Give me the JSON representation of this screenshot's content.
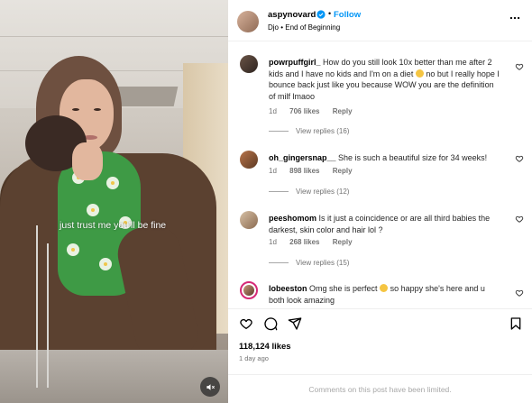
{
  "post": {
    "author": "aspynovard",
    "follow_label": "Follow",
    "audio": "Djo • End of Beginning",
    "video_overlay_text": "just trust me you'll be fine",
    "likes": "118,124 likes",
    "time_ago": "1 day ago",
    "comments_limited": "Comments on this post have been limited."
  },
  "comments": [
    {
      "user": "powrpuffgirl_",
      "text_before": "How do you still look 10x better than me after 2 kids and I have no kids and I'm on a diet",
      "text_after": " no but I really hope I bounce back just like you because WOW you are the definition of milf lmaoo",
      "age": "1d",
      "likes": "706 likes",
      "reply_label": "Reply",
      "view_replies": "View replies (16)"
    },
    {
      "user": "oh_gingersnap__",
      "text_before": "She is such a beautiful size for 34 weeks!",
      "text_after": "",
      "age": "1d",
      "likes": "898 likes",
      "reply_label": "Reply",
      "view_replies": "View replies (12)"
    },
    {
      "user": "peeshomom",
      "text_before": "Is it just a coincidence or are all third babies the darkest, skin color and hair lol ?",
      "text_after": "",
      "age": "1d",
      "likes": "268 likes",
      "reply_label": "Reply",
      "view_replies": "View replies (15)"
    },
    {
      "user": "lobeeston",
      "text_before": "Omg she is perfect",
      "text_after": " so happy she's here and u both look amazing",
      "age": "",
      "likes": "",
      "reply_label": "",
      "view_replies": ""
    }
  ],
  "colors": {
    "accent": "#0095f6",
    "muted": "#737373",
    "verified": "#0095f6"
  },
  "icons": [
    "more-icon",
    "heart-icon",
    "comment-icon",
    "share-icon",
    "bookmark-icon",
    "mute-icon",
    "verified-icon"
  ]
}
